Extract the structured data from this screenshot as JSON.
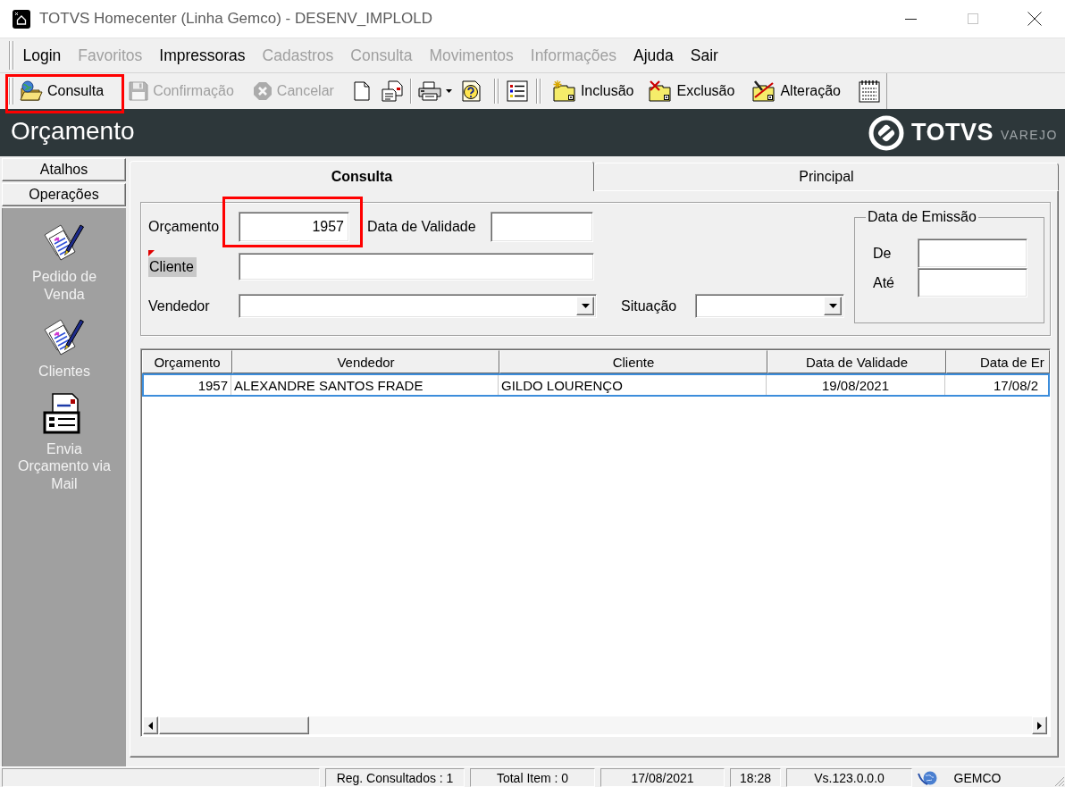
{
  "window": {
    "title": "TOTVS Homecenter (Linha Gemco) - DESENV_IMPLOLD"
  },
  "menu": [
    {
      "label": "Login",
      "disabled": false
    },
    {
      "label": "Favoritos",
      "disabled": true
    },
    {
      "label": "Impressoras",
      "disabled": false
    },
    {
      "label": "Cadastros",
      "disabled": true
    },
    {
      "label": "Consulta",
      "disabled": true
    },
    {
      "label": "Movimentos",
      "disabled": true
    },
    {
      "label": "Informações",
      "disabled": true
    },
    {
      "label": "Ajuda",
      "disabled": false
    },
    {
      "label": "Sair",
      "disabled": false
    }
  ],
  "toolbar": {
    "buttons": [
      {
        "label": "Consulta",
        "disabled": false,
        "highlighted": true
      },
      {
        "label": "Confirmação",
        "disabled": true,
        "highlighted": false
      },
      {
        "label": "Cancelar",
        "disabled": true,
        "highlighted": false
      },
      {
        "label": "Inclusão",
        "disabled": false,
        "highlighted": false
      },
      {
        "label": "Exclusão",
        "disabled": false,
        "highlighted": false
      },
      {
        "label": "Alteração",
        "disabled": false,
        "highlighted": false
      }
    ]
  },
  "header": {
    "title": "Orçamento",
    "logo": {
      "name": "TOTVS",
      "tagline": "VAREJO"
    }
  },
  "sidebar": {
    "sections": [
      {
        "label": "Atalhos"
      },
      {
        "label": "Operações",
        "items": [
          {
            "label": "Pedido de Venda"
          },
          {
            "label": "Clientes"
          },
          {
            "label": "Envia Orçamento via Mail"
          }
        ]
      }
    ]
  },
  "tabs": [
    {
      "label": "Consulta",
      "selected": true
    },
    {
      "label": "Principal",
      "selected": false
    }
  ],
  "form": {
    "rows": [
      {
        "fields": [
          {
            "kind": "number",
            "label": "Orçamento",
            "value": "1957",
            "highlighted": true,
            "flagged": false
          },
          {
            "kind": "text",
            "label": "Data de Validade",
            "highlighted": false,
            "flagged": false
          }
        ]
      },
      {
        "fields": [
          {
            "kind": "text",
            "label": "Cliente",
            "highlighted": false,
            "flagged": true
          }
        ]
      },
      {
        "fields": [
          {
            "kind": "combo",
            "label": "Vendedor",
            "highlighted": false,
            "flagged": false
          },
          {
            "kind": "combo",
            "label": "Situação",
            "highlighted": false,
            "flagged": false
          }
        ]
      }
    ],
    "date_group": {
      "title": "Data de Emissão",
      "fields": [
        {
          "label": "De"
        },
        {
          "label": "Até"
        }
      ]
    }
  },
  "grid": {
    "columns": [
      "Orçamento",
      "Vendedor",
      "Cliente",
      "Data de Validade",
      "Data de Er"
    ],
    "rows": [
      {
        "cells": [
          "1957",
          "ALEXANDRE SANTOS FRADE",
          "GILDO LOURENÇO",
          "19/08/2021",
          "17/08/2"
        ],
        "selected": true
      }
    ]
  },
  "status_bar": {
    "panels": [
      "Reg. Consultados : 1",
      "Total Item : 0",
      "17/08/2021",
      "18:28",
      "Vs.123.0.0.0",
      "GEMCO"
    ]
  }
}
